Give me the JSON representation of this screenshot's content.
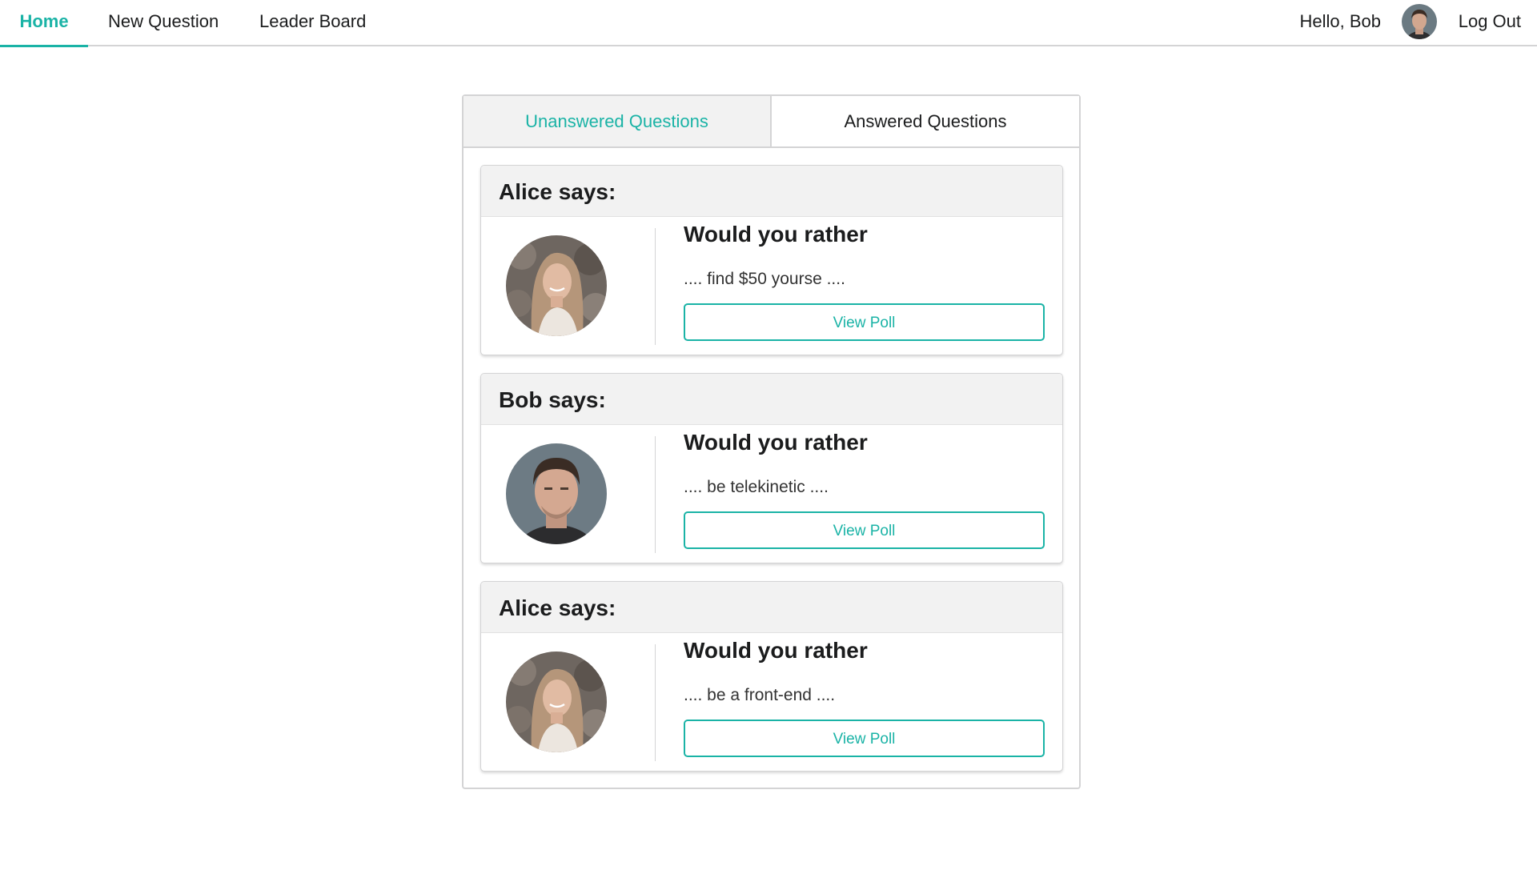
{
  "nav": {
    "home_label": "Home",
    "new_question_label": "New Question",
    "leader_board_label": "Leader Board",
    "greeting": "Hello, Bob",
    "logout_label": "Log Out",
    "active": "Home"
  },
  "tabs": {
    "unanswered_label": "Unanswered Questions",
    "answered_label": "Answered Questions",
    "active": "Unanswered Questions"
  },
  "questions": [
    {
      "header": "Alice says:",
      "title": "Would you rather",
      "snippet": ".... find $50 yourse ....",
      "button_label": "View Poll",
      "avatar": "alice-avatar"
    },
    {
      "header": "Bob says:",
      "title": "Would you rather",
      "snippet": ".... be telekinetic ....",
      "button_label": "View Poll",
      "avatar": "bob-avatar"
    },
    {
      "header": "Alice says:",
      "title": "Would you rather",
      "snippet": ".... be a front-end ....",
      "button_label": "View Poll",
      "avatar": "alice-avatar"
    }
  ],
  "colors": {
    "accent": "#1ab3a6",
    "border": "#d4d4d5",
    "header_bg": "#f2f2f2"
  }
}
